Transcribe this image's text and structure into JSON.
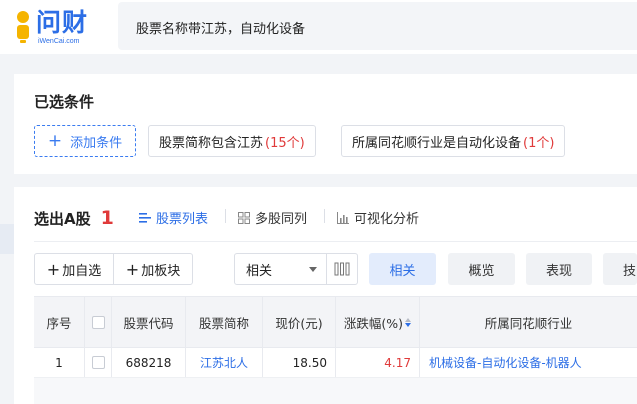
{
  "header": {
    "logo_text": "问财",
    "logo_sub": "iWenCai.com",
    "query": "股票名称带江苏，自动化设备"
  },
  "conditions": {
    "title": "已选条件",
    "add_label": "添加条件",
    "chips": [
      {
        "label": "股票简称包含江苏",
        "count": "(15个)"
      },
      {
        "label": "所属同花顺行业是自动化设备",
        "count": "(1个)"
      }
    ]
  },
  "results": {
    "title": "选出A股",
    "count": "1",
    "view_tabs": [
      {
        "label": "股票列表",
        "icon": "list-icon",
        "active": true
      },
      {
        "label": "多股同列",
        "icon": "grid-icon",
        "active": false
      },
      {
        "label": "可视化分析",
        "icon": "bar-chart-icon",
        "active": false
      }
    ],
    "toolbar": {
      "add_watchlist": "加自选",
      "add_sector": "加板块",
      "sort_select": "相关",
      "segments": [
        "相关",
        "概览",
        "表现",
        "技"
      ]
    },
    "table": {
      "headers": [
        "序号",
        "",
        "股票代码",
        "股票简称",
        "现价(元)",
        "涨跌幅(%)",
        "所属同花顺行业"
      ],
      "rows": [
        {
          "index": "1",
          "code": "688218",
          "name": "江苏北人",
          "price": "18.50",
          "change": "4.17",
          "industry": "机械设备-自动化设备-机器人"
        }
      ]
    }
  },
  "colors": {
    "accent": "#2c6ee6",
    "up": "#e03a3a"
  }
}
